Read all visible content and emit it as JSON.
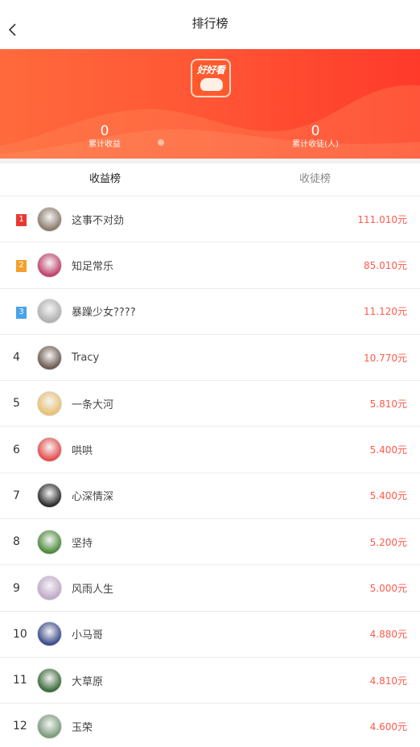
{
  "header": {
    "title": "排行榜"
  },
  "banner": {
    "logo_text": "好好看",
    "left_value": "0",
    "left_label": "累计收益",
    "right_value": "0",
    "right_label": "累计收徒(人)"
  },
  "tabs": [
    {
      "label": "收益榜",
      "active": true
    },
    {
      "label": "收徒榜",
      "active": false
    }
  ],
  "rows": [
    {
      "rank": "1",
      "name": "这事不对劲",
      "amount": "111.010元",
      "avatar_color": "#8a7a6a"
    },
    {
      "rank": "2",
      "name": "知足常乐",
      "amount": "85.010元",
      "avatar_color": "#c0406a"
    },
    {
      "rank": "3",
      "name": "暴躁少女????",
      "amount": "11.120元",
      "avatar_color": "#b0b0b0"
    },
    {
      "rank": "4",
      "name": "Tracy",
      "amount": "10.770元",
      "avatar_color": "#6a5a50"
    },
    {
      "rank": "5",
      "name": "一条大河",
      "amount": "5.810元",
      "avatar_color": "#e8c070"
    },
    {
      "rank": "6",
      "name": "哄哄",
      "amount": "5.400元",
      "avatar_color": "#e84a4a"
    },
    {
      "rank": "7",
      "name": "心深情深",
      "amount": "5.400元",
      "avatar_color": "#2a2a2a"
    },
    {
      "rank": "8",
      "name": "坚持",
      "amount": "5.200元",
      "avatar_color": "#4a8a3a"
    },
    {
      "rank": "9",
      "name": "风雨人生",
      "amount": "5.000元",
      "avatar_color": "#c0a8c8"
    },
    {
      "rank": "10",
      "name": "小马哥",
      "amount": "4.880元",
      "avatar_color": "#3a4a8a"
    },
    {
      "rank": "11",
      "name": "大草原",
      "amount": "4.810元",
      "avatar_color": "#3a6a3a"
    },
    {
      "rank": "12",
      "name": "玉荣",
      "amount": "4.600元",
      "avatar_color": "#7a9a7a"
    }
  ]
}
